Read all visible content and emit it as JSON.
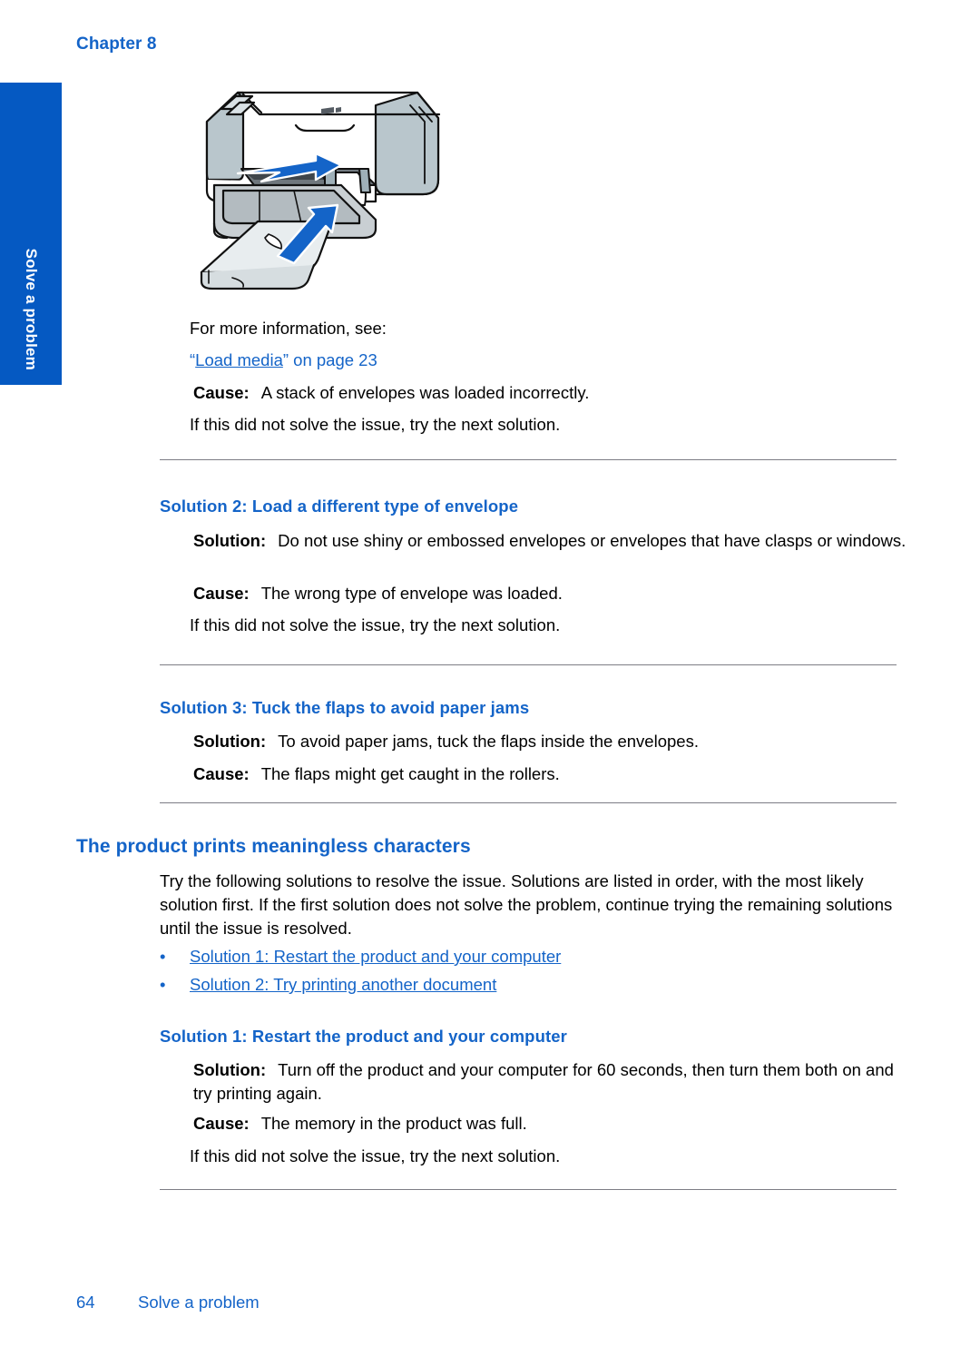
{
  "page": {
    "chapter_header": "Chapter 8",
    "side_tab_label": "Solve a problem",
    "footer_page_number": "64",
    "footer_title": "Solve a problem",
    "accent_blue": "#1464c8",
    "tab_blue": "#0559c2",
    "rule_color": "#7d7d85"
  },
  "illustration": {
    "name": "printer-load-envelopes-diagram",
    "alt": "All-in-one printer with input tray open and blue arrows showing envelope loading direction"
  },
  "intro": {
    "for_more_info": "For more information, see:",
    "link_quote_open": "“",
    "link_text": "Load media",
    "link_quote_close": "”",
    "link_suffix": " on page 23",
    "cause_label": "Cause:",
    "cause_text": "A stack of envelopes was loaded incorrectly.",
    "next_solution": "If this did not solve the issue, try the next solution."
  },
  "solution2_envelope": {
    "heading": "Solution 2: Load a different type of envelope",
    "solution_label": "Solution:",
    "solution_text": "Do not use shiny or embossed envelopes or envelopes that have clasps or windows.",
    "cause_label": "Cause:",
    "cause_text": "The wrong type of envelope was loaded.",
    "next_solution": "If this did not solve the issue, try the next solution."
  },
  "solution3_flaps": {
    "heading": "Solution 3: Tuck the flaps to avoid paper jams",
    "solution_label": "Solution:",
    "solution_text": "To avoid paper jams, tuck the flaps inside the envelopes.",
    "cause_label": "Cause:",
    "cause_text": "The flaps might get caught in the rollers."
  },
  "meaningless_characters": {
    "heading": "The product prints meaningless characters",
    "intro_paragraph": "Try the following solutions to resolve the issue. Solutions are listed in order, with the most likely solution first. If the first solution does not solve the problem, continue trying the remaining solutions until the issue is resolved.",
    "bullets": [
      {
        "marker": "•",
        "label": "Solution 1: Restart the product and your computer"
      },
      {
        "marker": "•",
        "label": "Solution 2: Try printing another document"
      }
    ]
  },
  "solution1_restart": {
    "heading": "Solution 1: Restart the product and your computer",
    "solution_label": "Solution:",
    "solution_text": "Turn off the product and your computer for 60 seconds, then turn them both on and try printing again.",
    "cause_label": "Cause:",
    "cause_text": "The memory in the product was full.",
    "next_solution": "If this did not solve the issue, try the next solution."
  }
}
